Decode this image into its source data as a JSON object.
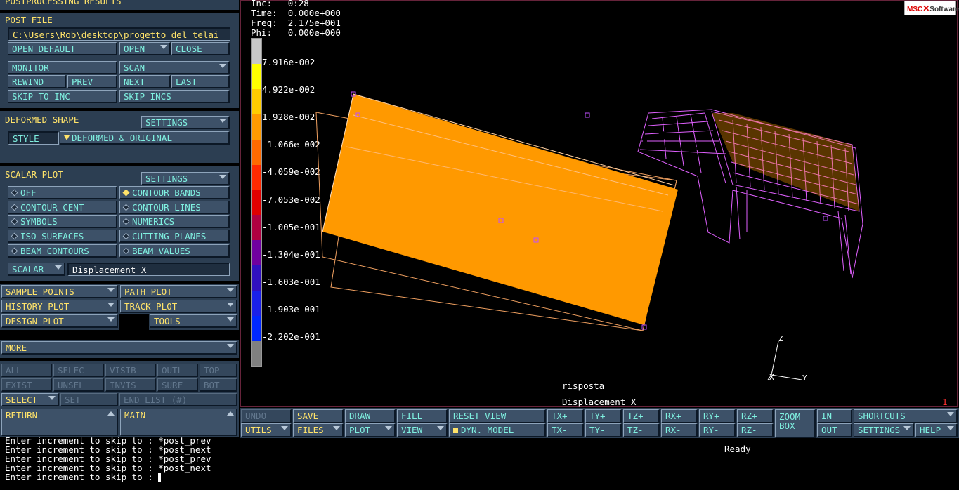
{
  "panel": {
    "title": "POSTPROCESSING RESULTS",
    "post_file": {
      "title": "POST FILE",
      "path": "C:\\Users\\Rob\\desktop\\progetto del telai",
      "open_default": "OPEN DEFAULT",
      "open": "OPEN",
      "close": "CLOSE"
    },
    "nav": {
      "monitor": "MONITOR",
      "scan": "SCAN",
      "rewind": "REWIND",
      "prev": "PREV",
      "next": "NEXT",
      "last": "LAST",
      "skip_to_inc": "SKIP TO INC",
      "skip_incs": "SKIP INCS"
    },
    "deformed": {
      "title": "DEFORMED SHAPE",
      "settings": "SETTINGS",
      "style_label": "STYLE",
      "style_value": "DEFORMED & ORIGINAL"
    },
    "scalar": {
      "title": "SCALAR PLOT",
      "settings": "SETTINGS",
      "off": "OFF",
      "contour_bands": "CONTOUR BANDS",
      "contour_cent": "CONTOUR CENT",
      "contour_lines": "CONTOUR LINES",
      "symbols": "SYMBOLS",
      "numerics": "NUMERICS",
      "iso_surfaces": "ISO-SURFACES",
      "cutting_planes": "CUTTING PLANES",
      "beam_contours": "BEAM CONTOURS",
      "beam_values": "BEAM VALUES",
      "scalar_label": "SCALAR",
      "scalar_value": "Displacement X"
    },
    "plots": {
      "sample_points": "SAMPLE POINTS",
      "path_plot": "PATH PLOT",
      "history_plot": "HISTORY PLOT",
      "track_plot": "TRACK PLOT",
      "design_plot": "DESIGN PLOT",
      "tools": "TOOLS"
    },
    "more": "MORE",
    "sel": {
      "all": "ALL",
      "selec": "SELEC",
      "visib": "VISIB",
      "outl": "OUTL",
      "top": "TOP",
      "exist": "EXIST",
      "unsel": "UNSEL",
      "invis": "INVIS",
      "surf": "SURF",
      "bot": "BOT",
      "select": "SELECT",
      "set": "SET",
      "end_list": "END LIST (#)"
    },
    "return": "RETURN",
    "main": "MAIN"
  },
  "viewport": {
    "inc_label": "Inc:",
    "inc": "0:28",
    "time_label": "Time:",
    "time": "0.000e+000",
    "freq_label": "Freq:",
    "freq": "2.175e+001",
    "phi_label": "Phi:",
    "phi": "0.000e+000",
    "legend": [
      "7.916e-002",
      "4.922e-002",
      "1.928e-002",
      "-1.066e-002",
      "-4.059e-002",
      "-7.053e-002",
      "-1.005e-001",
      "-1.304e-001",
      "-1.603e-001",
      "-1.903e-001",
      "-2.202e-001"
    ],
    "legend_colors": [
      "#c8c8c8",
      "#ffff00",
      "#ffcc00",
      "#ff9a00",
      "#ff6a00",
      "#ff2a00",
      "#e00000",
      "#b00040",
      "#7000a0",
      "#3010c0",
      "#1a20e8",
      "#0028ff",
      "#808080"
    ],
    "job_name": "risposta",
    "result_name": "Displacement X",
    "window_index": "1",
    "axes": {
      "x": "X",
      "y": "Y",
      "z": "Z"
    },
    "logo_main": "MSC",
    "logo_sub": "Software"
  },
  "toolbar": {
    "undo": "UNDO",
    "save": "SAVE",
    "draw": "DRAW",
    "fill": "FILL",
    "reset_view": "RESET VIEW",
    "tx_plus": "TX+",
    "ty_plus": "TY+",
    "tz_plus": "TZ+",
    "rx_plus": "RX+",
    "ry_plus": "RY+",
    "rz_plus": "RZ+",
    "zoom_box_1": "ZOOM",
    "zoom_box_2": "BOX",
    "in": "IN",
    "shortcuts": "SHORTCUTS",
    "utils": "UTILS",
    "files": "FILES",
    "plot": "PLOT",
    "view": "VIEW",
    "dyn_model": "DYN. MODEL",
    "tx_minus": "TX-",
    "ty_minus": "TY-",
    "tz_minus": "TZ-",
    "rx_minus": "RX-",
    "ry_minus": "RY-",
    "rz_minus": "RZ-",
    "out": "OUT",
    "settings": "SETTINGS",
    "help": "HELP"
  },
  "console": {
    "lines": [
      "Enter increment to skip to : *post_prev",
      "Enter increment to skip to : *post_next",
      "Enter increment to skip to : *post_prev",
      "Enter increment to skip to : *post_next",
      "Enter increment to skip to : "
    ],
    "status": "Ready"
  }
}
